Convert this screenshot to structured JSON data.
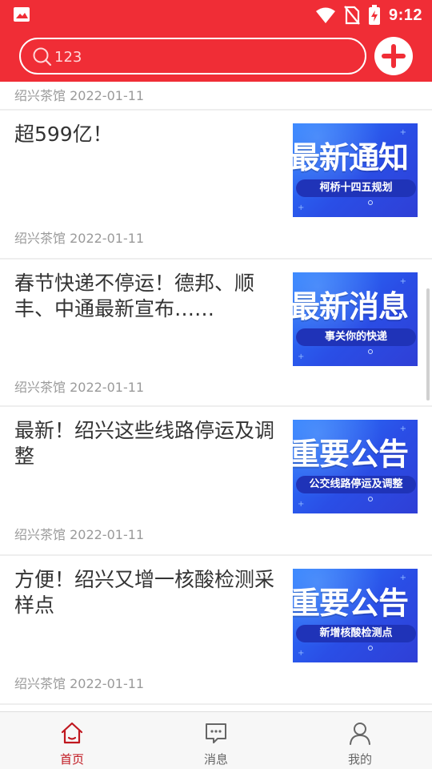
{
  "status_bar": {
    "time": "9:12",
    "icons": [
      "image-icon",
      "wifi-icon",
      "no-sim-icon",
      "battery-charging-icon"
    ]
  },
  "header": {
    "search_value": "123",
    "search_icon": "search-icon",
    "add_icon": "plus-icon"
  },
  "colors": {
    "header_bg": "#f02d36",
    "active_tab": "#c0171f",
    "thumb_blue": "#2a4ee6"
  },
  "feed": {
    "partial_meta": "绍兴茶馆 2022-01-11",
    "items": [
      {
        "title": "超599亿！",
        "meta": "绍兴茶馆 2022-01-11",
        "thumb_big": "最新通知",
        "thumb_pill": "柯桥十四五规划"
      },
      {
        "title": "春节快递不停运！德邦、顺丰、中通最新宣布……",
        "meta": "绍兴茶馆 2022-01-11",
        "thumb_big": "最新消息",
        "thumb_pill": "事关你的快递"
      },
      {
        "title": "最新！绍兴这些线路停运及调整",
        "meta": "绍兴茶馆 2022-01-11",
        "thumb_big": "重要公告",
        "thumb_pill": "公交线路停运及调整"
      },
      {
        "title": "方便！绍兴又增一核酸检测采样点",
        "meta": "绍兴茶馆 2022-01-11",
        "thumb_big": "重要公告",
        "thumb_pill": "新增核酸检测点"
      }
    ]
  },
  "bottom_nav": {
    "tabs": [
      {
        "label": "首页",
        "icon": "home-icon",
        "active": true
      },
      {
        "label": "消息",
        "icon": "message-icon",
        "active": false
      },
      {
        "label": "我的",
        "icon": "user-icon",
        "active": false
      }
    ]
  }
}
